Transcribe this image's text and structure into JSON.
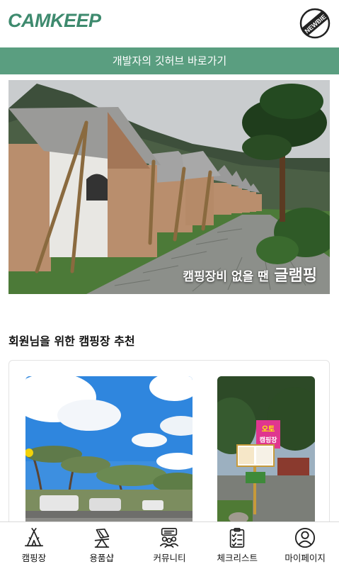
{
  "header": {
    "logo_text": "CAMKEEP",
    "badge_text": "NEWBIE"
  },
  "github_link": "개발자의 깃허브 바로가기",
  "banner": {
    "caption_small": "캠핑장비 없을 땐",
    "caption_big": "글램핑"
  },
  "recommend": {
    "title": "회원님을 위한 캠핑장 추천",
    "sign_text_1": "오토",
    "sign_text_2": "캠핑장"
  },
  "tabs": [
    {
      "label": "캠핑장",
      "icon": "campfire-tent-icon"
    },
    {
      "label": "용품샵",
      "icon": "camping-chair-icon"
    },
    {
      "label": "커뮤니티",
      "icon": "community-icon"
    },
    {
      "label": "체크리스트",
      "icon": "checklist-icon"
    },
    {
      "label": "마이페이지",
      "icon": "user-icon"
    }
  ],
  "colors": {
    "brand": "#3e8a6e",
    "bar": "#5a9e80"
  }
}
